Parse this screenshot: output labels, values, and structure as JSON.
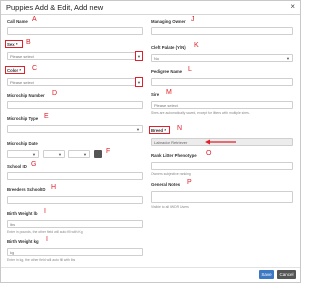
{
  "dialog": {
    "title": "Puppies Add & Edit, Add new",
    "close": "×"
  },
  "left": {
    "call_name": {
      "label": "Call Name",
      "tag": "A"
    },
    "sex": {
      "label": "Sex *",
      "tag": "B",
      "placeholder": "Please select"
    },
    "color": {
      "label": "Color *",
      "tag": "C",
      "placeholder": "Please select"
    },
    "microchip_number": {
      "label": "Microchip Number",
      "tag": "D"
    },
    "microchip_type": {
      "label": "Microchip Type",
      "tag": "E"
    },
    "microchip_date": {
      "label": "Microchip Date",
      "tag": "F"
    },
    "school_id": {
      "label": "School ID",
      "tag": "G"
    },
    "breeders_school_id": {
      "label": "Breeders SchoolID",
      "tag": "H"
    },
    "birth_weight_lb": {
      "label": "Birth Weight lb",
      "tag": "I",
      "placeholder": "lbs",
      "help": "Enter in pounds, the other field will auto fill with Kg"
    },
    "birth_weight_kg": {
      "label": "Birth Weight kg",
      "tag": "I",
      "placeholder": "kg",
      "help": "Enter in kg, the other field will auto fill with lbs"
    }
  },
  "right": {
    "managing_owner": {
      "label": "Managing Owner",
      "tag": "J"
    },
    "cleft_palate": {
      "label": "Cleft Palate (Y/N)",
      "tag": "K",
      "value": "No"
    },
    "pedigree_name": {
      "label": "Pedigree Name",
      "tag": "L"
    },
    "sire": {
      "label": "Sire",
      "tag": "M",
      "placeholder": "Please select",
      "help": "Sires are automatically saved, except for litters with multiple sires."
    },
    "breed": {
      "label": "Breed *",
      "tag": "N",
      "value": "Labrador Retriever"
    },
    "rank_litter_phenotype": {
      "label": "Rank Litter Phenotype",
      "tag": "O",
      "help": "Owners subjective ranking"
    },
    "general_notes": {
      "label": "General Notes",
      "tag": "P",
      "help": "Visible to all IWDR Users"
    }
  },
  "footer": {
    "save_label": "Save",
    "cancel_label": "Cancel"
  },
  "colors": {
    "annotation": "#e0202a",
    "save": "#3c78c3",
    "cancel": "#555555"
  }
}
